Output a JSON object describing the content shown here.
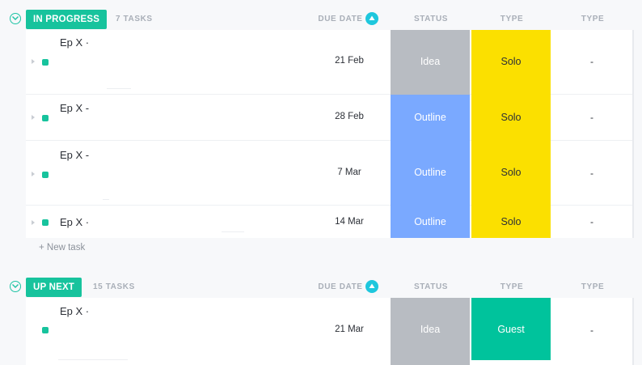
{
  "colors": {
    "accent": "#17c39d",
    "sort_badge": "#1ec7dd",
    "status_idea": "#b8bcc2",
    "status_outline": "#7aa9ff",
    "type_solo": "#fbe000",
    "type_guest": "#00c39c"
  },
  "columns": {
    "due_date": "DUE DATE",
    "status": "STATUS",
    "type": "TYPE",
    "type2": "TYPE"
  },
  "groups": [
    {
      "label": "IN PROGRESS",
      "count": "7 TASKS",
      "new_task": "+ New task",
      "tasks": [
        {
          "name": "Ep X ·",
          "due": "21 Feb",
          "status": "Idea",
          "type": "Solo",
          "type2": "-"
        },
        {
          "name": "Ep X -",
          "due": "28 Feb",
          "status": "Outline",
          "type": "Solo",
          "type2": "-"
        },
        {
          "name": "Ep X -",
          "due": "7 Mar",
          "status": "Outline",
          "type": "Solo",
          "type2": "-"
        },
        {
          "name": "Ep X ·",
          "due": "14 Mar",
          "status": "Outline",
          "type": "Solo",
          "type2": "-"
        }
      ]
    },
    {
      "label": "UP NEXT",
      "count": "15 TASKS",
      "tasks": [
        {
          "name": "Ep X ·",
          "due": "21 Mar",
          "status": "Idea",
          "type": "Guest",
          "type2": "-"
        }
      ]
    }
  ]
}
